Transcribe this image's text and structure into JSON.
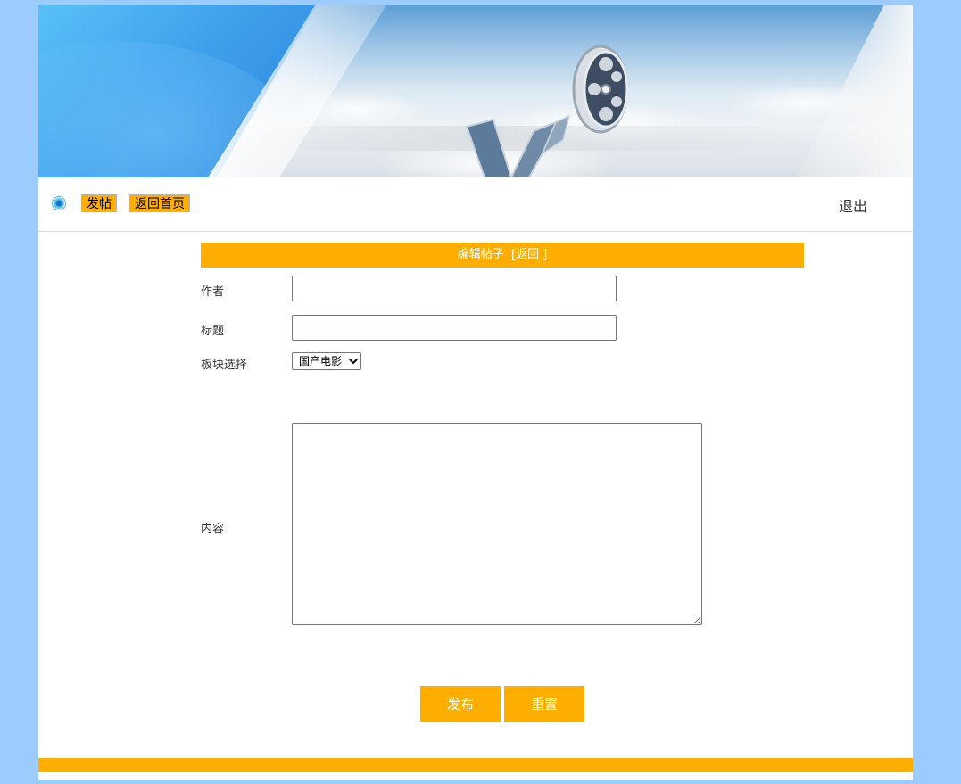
{
  "nav": {
    "post_label": "发帖",
    "home_label": "返回首页",
    "logout_label": "退出"
  },
  "form": {
    "header_title": "编辑帖子",
    "back_label": "[返回 ]",
    "author_label": "作者",
    "author_value": "",
    "title_label": "标题",
    "title_value": "",
    "board_label": "板块选择",
    "board_selected": "国产电影",
    "content_label": "内容",
    "content_value": "",
    "publish_label": "发布",
    "reset_label": "重置"
  },
  "colors": {
    "accent": "#ffae00",
    "background": "#9ccbfd",
    "panel": "#ffffff"
  },
  "icons": {
    "banner": "film-reel-icon",
    "nav_bullet": "nav-dot-icon"
  }
}
